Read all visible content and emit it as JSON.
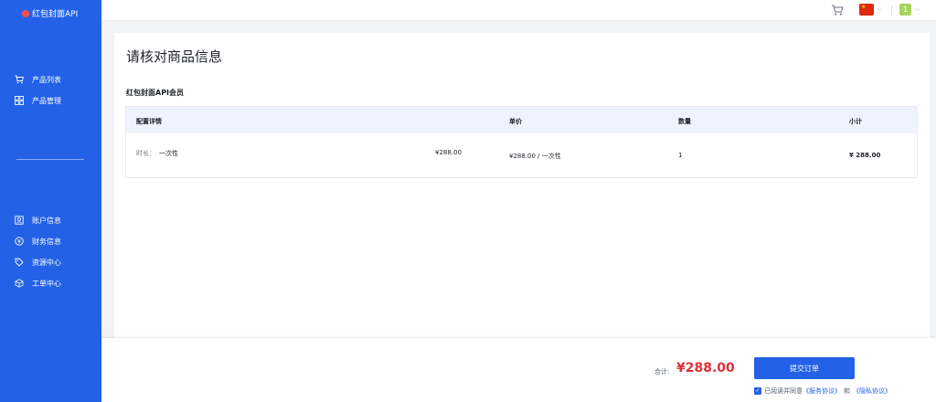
{
  "sidebar": {
    "logo_text": "红包封面API",
    "items_top": [
      {
        "label": "产品列表",
        "icon": "cart-icon"
      },
      {
        "label": "产品管理",
        "icon": "grid-icon"
      }
    ],
    "items_bottom": [
      {
        "label": "账户信息",
        "icon": "account-icon"
      },
      {
        "label": "财务信息",
        "icon": "finance-icon"
      },
      {
        "label": "资源中心",
        "icon": "tag-icon"
      },
      {
        "label": "工单中心",
        "icon": "cube-icon"
      }
    ]
  },
  "topbar": {
    "avatar_text": "1"
  },
  "page": {
    "title": "请核对商品信息",
    "product_name": "红包封面API会员"
  },
  "table": {
    "headers": [
      "配置详情",
      "单价",
      "数量",
      "小计"
    ],
    "row": {
      "config_label": "时长：",
      "config_value": "一次性",
      "config_price": "¥288.00",
      "unit_price": "¥288.00 / 一次性",
      "quantity": "1",
      "subtotal": "¥ 288.00"
    }
  },
  "footer": {
    "total_label": "合计:",
    "total_value": "¥288.00",
    "submit_label": "提交订单",
    "agree_prefix": "已阅读并同意",
    "service_agreement": "《服务协议》",
    "and": "和",
    "privacy_agreement": "《隐私协议》"
  },
  "colors": {
    "brand": "#2362e6",
    "price": "#e0303a",
    "table_header_bg": "#eef3fd"
  }
}
